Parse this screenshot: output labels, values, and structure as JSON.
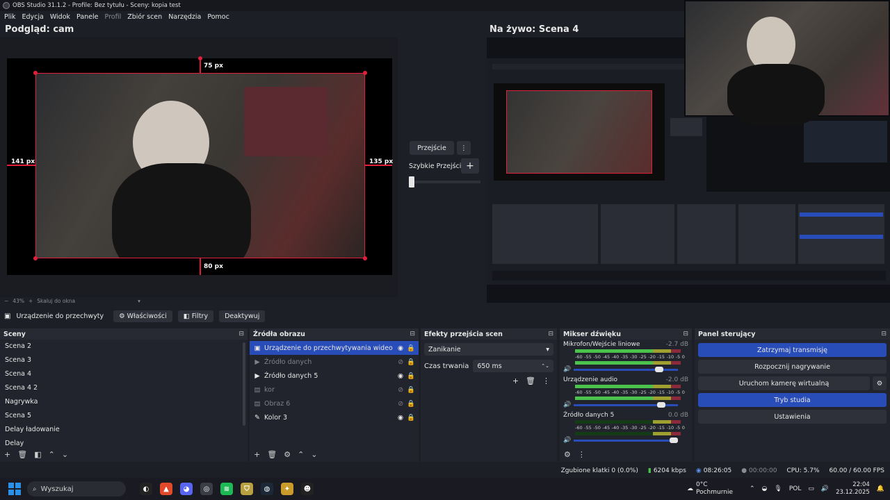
{
  "window": {
    "title": "OBS Studio 31.1.2 - Profile: Bez tytułu - Sceny: kopia test"
  },
  "menu": [
    "Plik",
    "Edycja",
    "Widok",
    "Panele",
    "Profil",
    "Zbiór scen",
    "Narzędzia",
    "Pomoc"
  ],
  "preview": {
    "title": "Podgląd: cam",
    "guides": {
      "top": "75 px",
      "left": "141 px",
      "right": "135 px",
      "bottom": "80 px"
    },
    "zoom": "43%",
    "fit_label": "Skaluj do okna"
  },
  "live": {
    "title": "Na żywo: Scena 4"
  },
  "transition": {
    "button": "Przejście",
    "quick_label": "Szybkie Przejścia"
  },
  "source_toolbar": {
    "source_name": "Urządzenie do przechwyty",
    "properties": "Właściwości",
    "filters": "Filtry",
    "deactivate": "Deaktywuj"
  },
  "scenes": {
    "title": "Sceny",
    "items": [
      "Scena 2",
      "Scena 3",
      "Scena 4",
      "Scena 4 2",
      "Nagrywka",
      "Scena 5",
      "Delay ładowanie",
      "Delay"
    ]
  },
  "sources": {
    "title": "Źródła obrazu",
    "items": [
      {
        "name": "Urządzenie do przechwytywania wideo",
        "icon": "camera-icon",
        "visible": true,
        "selected": true
      },
      {
        "name": "Źródło danych",
        "icon": "play-icon",
        "visible": false,
        "selected": false
      },
      {
        "name": "Źródło danych 5",
        "icon": "play-icon",
        "visible": true,
        "selected": false
      },
      {
        "name": "kor",
        "icon": "image-icon",
        "visible": false,
        "selected": false
      },
      {
        "name": "Obraz 6",
        "icon": "image-icon",
        "visible": false,
        "selected": false
      },
      {
        "name": "Kolor 3",
        "icon": "brush-icon",
        "visible": true,
        "selected": false
      }
    ]
  },
  "scene_transitions": {
    "title": "Efekty przejścia scen",
    "selected": "Zanikanie",
    "duration_label": "Czas trwania",
    "duration_value": "650 ms"
  },
  "mixer": {
    "title": "Mikser dźwięku",
    "ticks": [
      "-60",
      "-55",
      "-50",
      "-45",
      "-40",
      "-35",
      "-30",
      "-25",
      "-20",
      "-15",
      "-10",
      "-5",
      "0"
    ],
    "channels": [
      {
        "name": "Mikrofon/Wejście liniowe",
        "db": "-2.7 dB",
        "level": 0.92,
        "volume": 0.86
      },
      {
        "name": "Urządzenie audio",
        "db": "-2.0 dB",
        "level": 0.95,
        "volume": 0.88
      },
      {
        "name": "Źródło danych 5",
        "db": "0.0 dB",
        "level": 0.0,
        "volume": 1.0
      }
    ]
  },
  "controls": {
    "title": "Panel sterujący",
    "stop_stream": "Zatrzymaj transmisję",
    "start_record": "Rozpocznij nagrywanie",
    "virtual_cam": "Uruchom kamerę wirtualną",
    "studio_mode": "Tryb studia",
    "settings": "Ustawienia"
  },
  "status": {
    "dropped": "Zgubione klatki 0 (0.0%)",
    "bitrate": "6204 kbps",
    "stream_time": "08:26:05",
    "rec_time": "00:00:00",
    "cpu": "CPU: 5.7%",
    "fps": "60.00 / 60.00 FPS"
  },
  "taskbar": {
    "search": "Wyszukaj",
    "weather_temp": "0°C",
    "weather_desc": "Pochmurnie",
    "lang": "POL",
    "time": "22:04",
    "date": "23.12.2025"
  },
  "colors": {
    "accent": "#284cb8",
    "guide": "#e0203a",
    "bg": "#1d1f26"
  }
}
